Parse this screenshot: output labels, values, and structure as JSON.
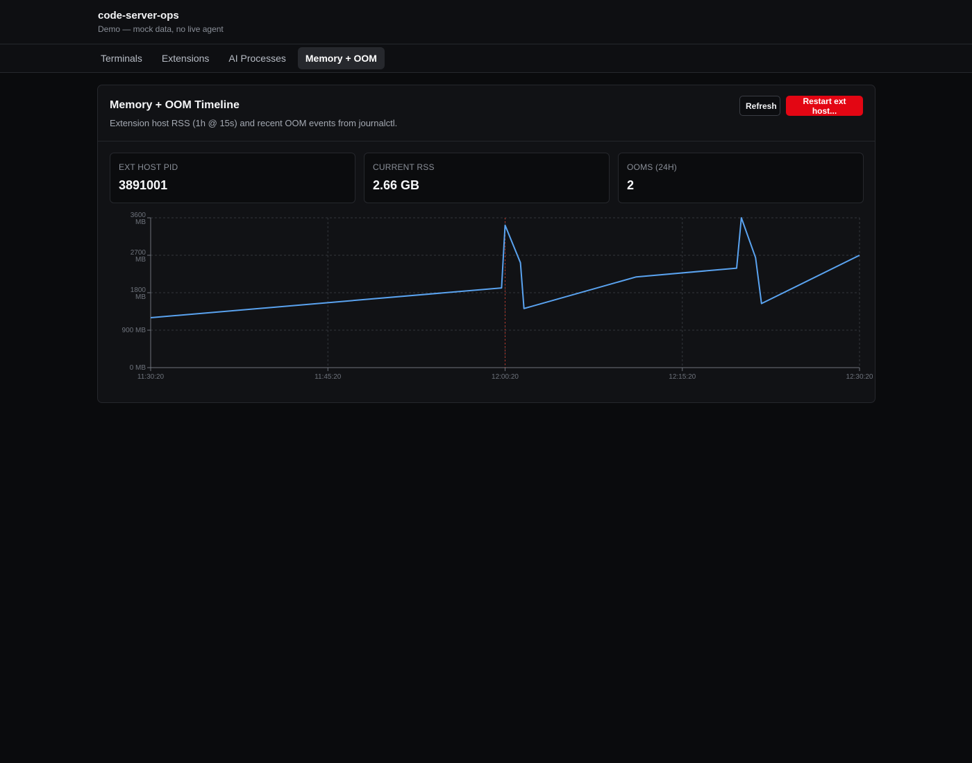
{
  "app": {
    "title": "code-server-ops",
    "subtitle": "Demo — mock data, no live agent"
  },
  "tabs": [
    {
      "label": "Terminals",
      "active": false
    },
    {
      "label": "Extensions",
      "active": false
    },
    {
      "label": "AI Processes",
      "active": false
    },
    {
      "label": "Memory + OOM",
      "active": true
    }
  ],
  "panel": {
    "title": "Memory + OOM Timeline",
    "description": "Extension host RSS (1h @ 15s) and recent OOM events from journalctl.",
    "refresh_label": "Refresh",
    "restart_label": "Restart ext host..."
  },
  "stats": [
    {
      "label": "EXT HOST PID",
      "value": "3891001"
    },
    {
      "label": "CURRENT RSS",
      "value": "2.66 GB"
    },
    {
      "label": "OOMS (24H)",
      "value": "2"
    }
  ],
  "colors": {
    "line": "#5aa3f0",
    "oom_marker": "#c0392b",
    "danger": "#e30613",
    "grid": "#33363c"
  },
  "chart_data": {
    "type": "line",
    "xlabel": "",
    "ylabel": "",
    "x_ticks": [
      "11:30:20",
      "11:45:20",
      "12:00:20",
      "12:15:20",
      "12:30:20"
    ],
    "y_ticks": [
      {
        "value": 0,
        "label": [
          "0 MB"
        ]
      },
      {
        "value": 900,
        "label": [
          "900 MB"
        ]
      },
      {
        "value": 1800,
        "label": [
          "1800",
          "MB"
        ]
      },
      {
        "value": 2700,
        "label": [
          "2700",
          "MB"
        ]
      },
      {
        "value": 3600,
        "label": [
          "3600",
          "MB"
        ]
      }
    ],
    "ylim": [
      0,
      3600
    ],
    "xlim_minutes": [
      0,
      60
    ],
    "grid": true,
    "oom_markers_minutes": [
      30
    ],
    "series": [
      {
        "name": "",
        "points": [
          [
            0,
            1200
          ],
          [
            29.7,
            1915
          ],
          [
            30.0,
            3420
          ],
          [
            31.3,
            2520
          ],
          [
            31.6,
            1420
          ],
          [
            41.1,
            2180
          ],
          [
            49.6,
            2390
          ],
          [
            50.0,
            3600
          ],
          [
            51.2,
            2640
          ],
          [
            51.7,
            1540
          ],
          [
            60,
            2700
          ]
        ]
      }
    ]
  }
}
